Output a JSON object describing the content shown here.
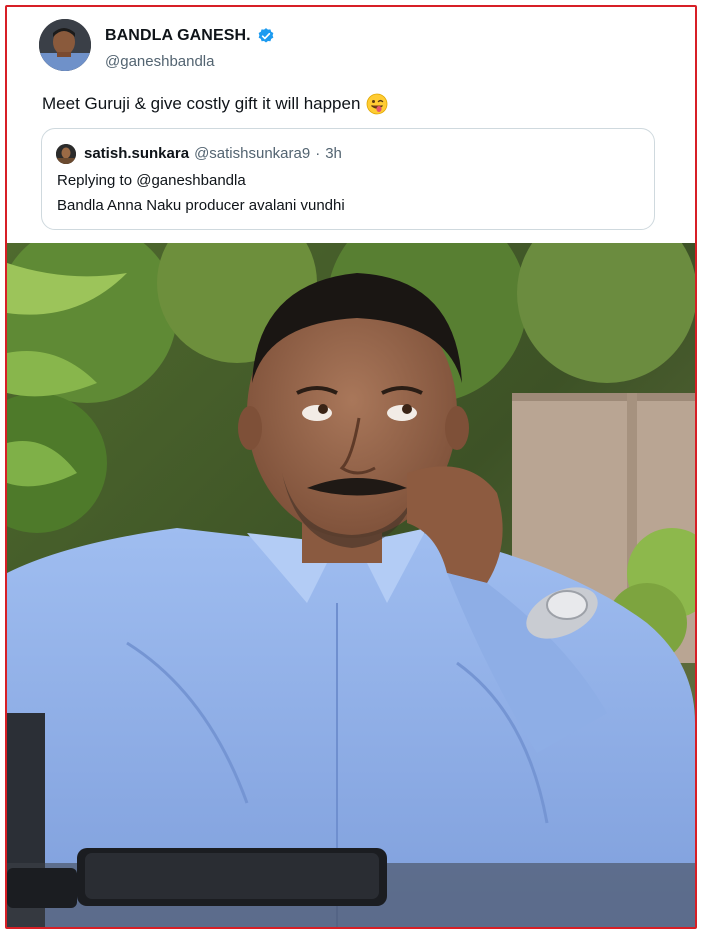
{
  "tweet": {
    "author_name": "BANDLA GANESH.",
    "author_handle": "@ganeshbandla",
    "text": "Meet Guruji & give costly gift it will happen",
    "emoji_name": "winking-face-with-tongue-icon"
  },
  "quoted_tweet": {
    "author_name": "satish.sunkara",
    "author_handle": "@satishsunkara9",
    "separator": "·",
    "time": "3h",
    "replying_to": "Replying to @ganeshbandla",
    "text": "Bandla Anna Naku producer avalani vundhi"
  },
  "colors": {
    "frame_border": "#d71f26",
    "verified_badge": "#1d9bf0",
    "secondary_text": "#536471",
    "shirt": "#8fb0e8"
  },
  "photo": {
    "subject": "man-in-blue-shirt-photo"
  }
}
